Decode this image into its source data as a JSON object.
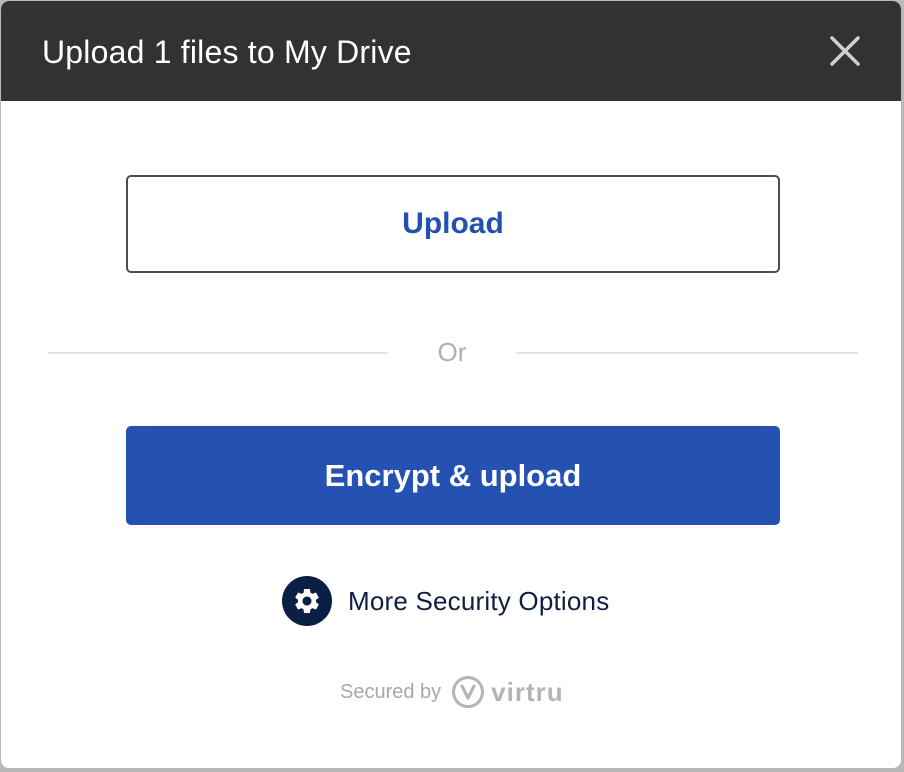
{
  "dialog": {
    "title": "Upload 1 files to My Drive",
    "close_icon": "close-icon"
  },
  "actions": {
    "upload_label": "Upload",
    "separator_label": "Or",
    "encrypt_upload_label": "Encrypt & upload"
  },
  "security_options": {
    "icon": "gear-icon",
    "label": "More Security Options"
  },
  "footer": {
    "secured_by": "Secured by",
    "brand": "virtru"
  },
  "colors": {
    "header_bg": "#323232",
    "primary": "#2451b2",
    "upload_text": "#2351b0",
    "gear_bg": "#0b1f45"
  }
}
